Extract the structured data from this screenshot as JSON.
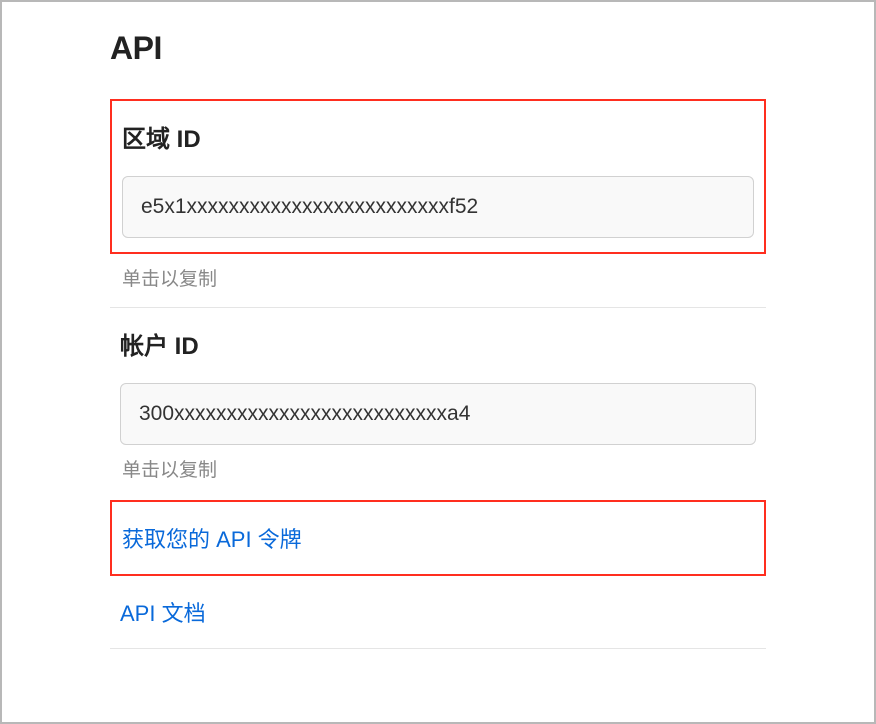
{
  "page_title": "API",
  "zone": {
    "label": "区域 ID",
    "value": "e5x1xxxxxxxxxxxxxxxxxxxxxxxxxf52",
    "hint": "单击以复制"
  },
  "account": {
    "label": "帐户 ID",
    "value": "300xxxxxxxxxxxxxxxxxxxxxxxxxxa4",
    "hint": "单击以复制"
  },
  "links": {
    "get_token": "获取您的 API 令牌",
    "api_docs": "API 文档"
  }
}
